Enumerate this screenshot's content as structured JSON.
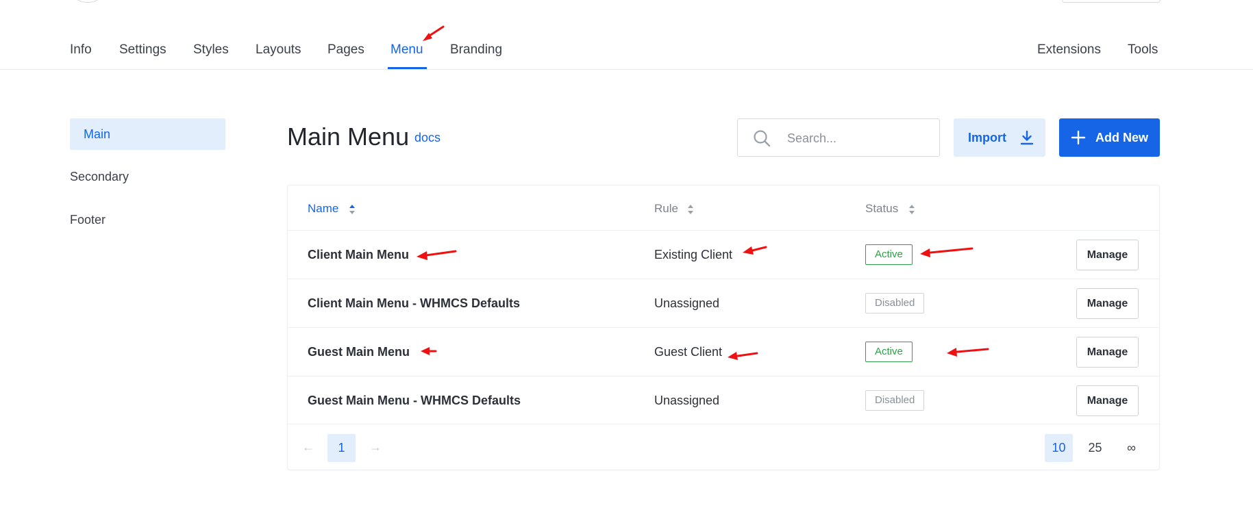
{
  "top_nav": {
    "tabs": [
      {
        "label": "Info"
      },
      {
        "label": "Settings"
      },
      {
        "label": "Styles"
      },
      {
        "label": "Layouts"
      },
      {
        "label": "Pages"
      },
      {
        "label": "Menu",
        "active": true
      },
      {
        "label": "Branding"
      }
    ],
    "right_tabs": [
      {
        "label": "Extensions"
      },
      {
        "label": "Tools"
      }
    ]
  },
  "sidebar": {
    "items": [
      {
        "label": "Main",
        "active": true
      },
      {
        "label": "Secondary"
      },
      {
        "label": "Footer"
      }
    ]
  },
  "header": {
    "title": "Main Menu",
    "docs_link": "docs"
  },
  "toolbar": {
    "search_placeholder": "Search...",
    "import_label": "Import",
    "add_new_label": "Add New"
  },
  "table": {
    "columns": [
      {
        "label": "Name",
        "sorted": true
      },
      {
        "label": "Rule"
      },
      {
        "label": "Status"
      }
    ],
    "rows": [
      {
        "name": "Client Main Menu",
        "rule": "Existing Client",
        "status": "Active",
        "action": "Manage"
      },
      {
        "name": "Client Main Menu - WHMCS Defaults",
        "rule": "Unassigned",
        "status": "Disabled",
        "action": "Manage"
      },
      {
        "name": "Guest Main Menu",
        "rule": "Guest Client",
        "status": "Active",
        "action": "Manage"
      },
      {
        "name": "Guest Main Menu - WHMCS Defaults",
        "rule": "Unassigned",
        "status": "Disabled",
        "action": "Manage"
      }
    ]
  },
  "pagination": {
    "prev_icon": "←",
    "next_icon": "→",
    "current_page": "1",
    "per_page_options": [
      "10",
      "25",
      "∞"
    ],
    "per_page_selected": "10"
  },
  "colors": {
    "accent": "#1565e6",
    "accent_light": "#e2eefc",
    "status_active": "#2e9e48",
    "status_disabled": "#8a9099",
    "annotation_arrow": "#ee1111"
  },
  "annotations": {
    "icon": "red-arrow-icon"
  }
}
